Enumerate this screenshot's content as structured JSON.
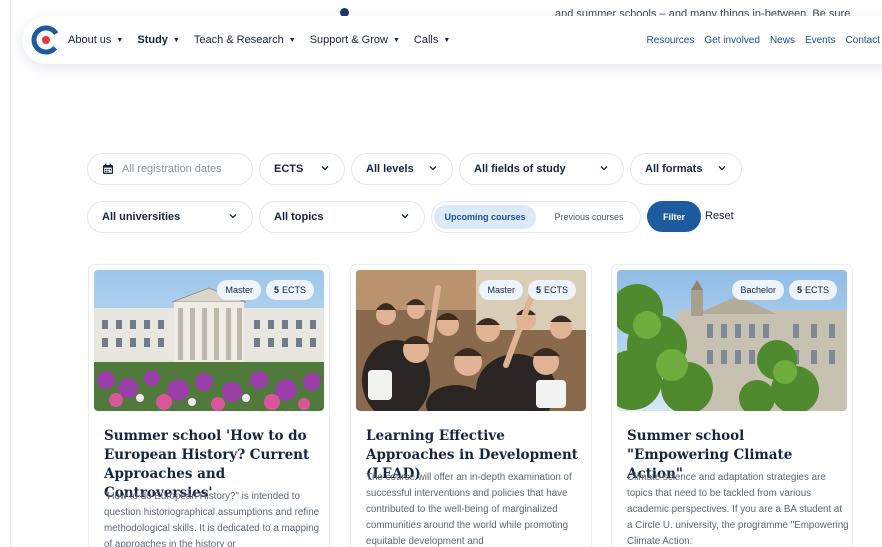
{
  "background": {
    "snippet": "and summer schools – and many things in-between. Be sure"
  },
  "header": {
    "logo_name": "circle-u-logo",
    "nav": [
      {
        "label": "About us",
        "bold": false
      },
      {
        "label": "Study",
        "bold": true
      },
      {
        "label": "Teach & Research",
        "bold": false
      },
      {
        "label": "Support & Grow",
        "bold": false
      },
      {
        "label": "Calls",
        "bold": false
      }
    ],
    "links": [
      "Resources",
      "Get involved",
      "News",
      "Events",
      "Contact"
    ]
  },
  "filters": {
    "dates_placeholder": "All registration dates",
    "ects": "ECTS",
    "levels": "All levels",
    "fields": "All fields of study",
    "formats": "All formats",
    "universities": "All universities",
    "topics": "All topics",
    "toggle_upcoming": "Upcoming courses",
    "toggle_previous": "Previous courses",
    "filter_button": "Filter",
    "reset": "Reset"
  },
  "cards": [
    {
      "level": "Master",
      "ects_value": "5",
      "ects_unit": "ECTS",
      "title": "Summer school 'How to do European History? Current Approaches and Controversies'",
      "text": "\"How to do European History?\" is intended to question historiographical assumptions and refine methodological skills. It is dedicated to a mapping of approaches in the history or"
    },
    {
      "level": "Master",
      "ects_value": "5",
      "ects_unit": "ECTS",
      "title": "Learning Effective Approaches in Development (LEAD)",
      "text": "The course will offer an in-depth examination of successful interventions and policies that have contributed to the well-being of marginalized communities around the world while promoting equitable development and"
    },
    {
      "level": "Bachelor",
      "ects_value": "5",
      "ects_unit": "ECTS",
      "title": "Summer school \"Empowering Climate Action\"",
      "text": "Climate science and adaptation strategies are topics that need to be tackled from various academic perspectives. If you are a BA student at a Circle U. university, the programme \"Empowering Climate Action:"
    }
  ],
  "colors": {
    "primary": "#1d5a9e",
    "navy": "#13253f",
    "accent_red": "#e23b3b",
    "chip_bg": "#eef4fb"
  }
}
